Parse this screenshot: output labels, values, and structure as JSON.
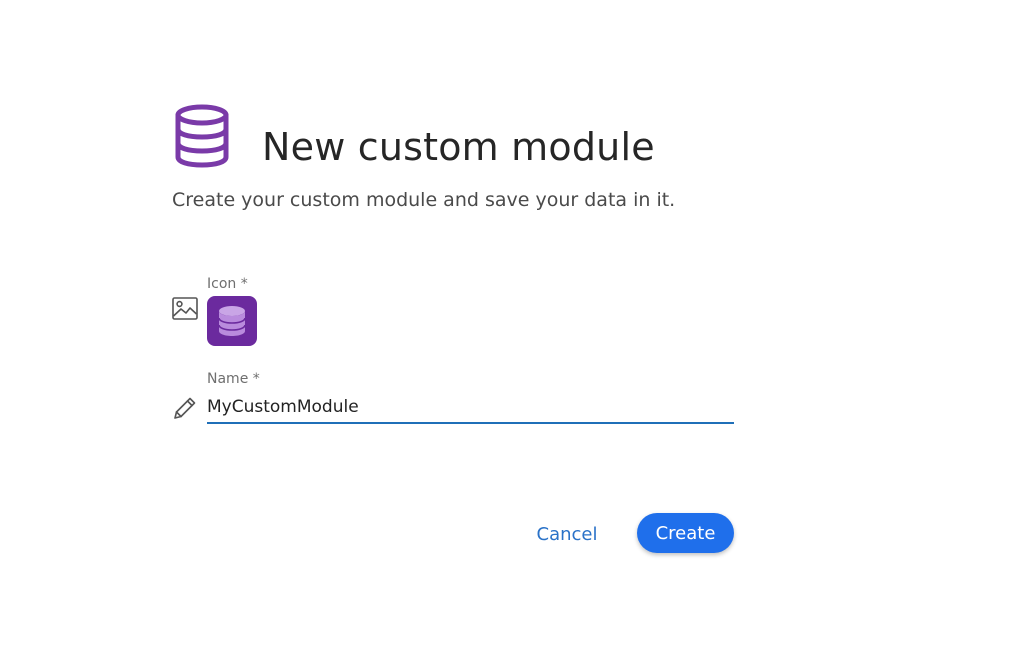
{
  "dialog": {
    "title": "New custom module",
    "subtitle": "Create your custom module and save your data in it.",
    "header_icon": "database-icon",
    "accent_color": "#6b2a9e"
  },
  "icon_field": {
    "label": "Icon *",
    "field_icon": "image-icon",
    "selected_icon": "database-icon",
    "selected_icon_bg": "#6b2a9e"
  },
  "name_field": {
    "label": "Name *",
    "field_icon": "pencil-icon",
    "value": "MyCustomModule",
    "underline_color": "#1f6fb8"
  },
  "actions": {
    "cancel_label": "Cancel",
    "create_label": "Create",
    "primary_color": "#1f6feb"
  }
}
